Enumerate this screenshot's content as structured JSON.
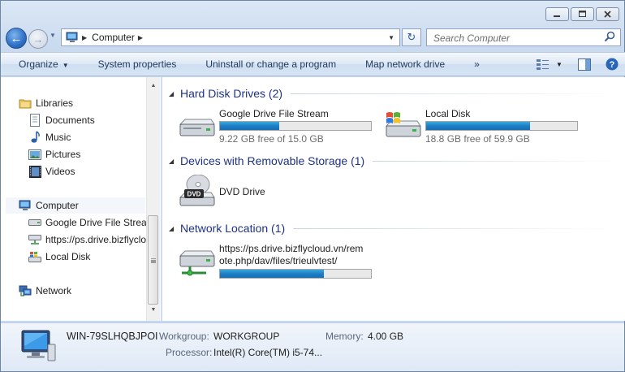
{
  "window": {
    "minimize_icon": "minimize-icon",
    "maximize_icon": "maximize-icon",
    "close_icon": "close-icon"
  },
  "address_bar": {
    "crumbs": [
      "Computer"
    ],
    "search_placeholder": "Search Computer"
  },
  "toolbar": {
    "items": [
      "Organize",
      "System properties",
      "Uninstall or change a program",
      "Map network drive",
      "»"
    ]
  },
  "nav_pane": {
    "libraries": "Libraries",
    "library_items": [
      "Documents",
      "Music",
      "Pictures",
      "Videos"
    ],
    "computer": "Computer",
    "computer_items": [
      "Google Drive File Stream",
      "https://ps.drive.bizflyclo",
      "Local Disk"
    ],
    "network": "Network"
  },
  "groups": {
    "hard_disks": {
      "title": "Hard Disk Drives (2)",
      "drives": [
        {
          "name": "Google Drive File Stream",
          "free": "9.22 GB free of 15.0 GB",
          "used_fraction": 0.39
        },
        {
          "name": "Local Disk",
          "free": "18.8 GB free of 59.9 GB",
          "used_fraction": 0.69
        }
      ]
    },
    "removable": {
      "title": "Devices with Removable Storage (1)",
      "drives": [
        {
          "name": "DVD Drive",
          "icon_text": "DVD"
        }
      ]
    },
    "network": {
      "title": "Network Location (1)",
      "drives": [
        {
          "name_line1": "https://ps.drive.bizflycloud.vn/rem",
          "name_line2": "ote.php/dav/files/trieulvtest/",
          "used_fraction": 0.69
        }
      ]
    }
  },
  "details": {
    "computer_name": "WIN-79SLHQBJPOI",
    "workgroup_label": "Workgroup:",
    "workgroup": "WORKGROUP",
    "memory_label": "Memory:",
    "memory": "4.00 GB",
    "processor_label": "Processor:",
    "processor": "Intel(R) Core(TM) i5-74..."
  }
}
